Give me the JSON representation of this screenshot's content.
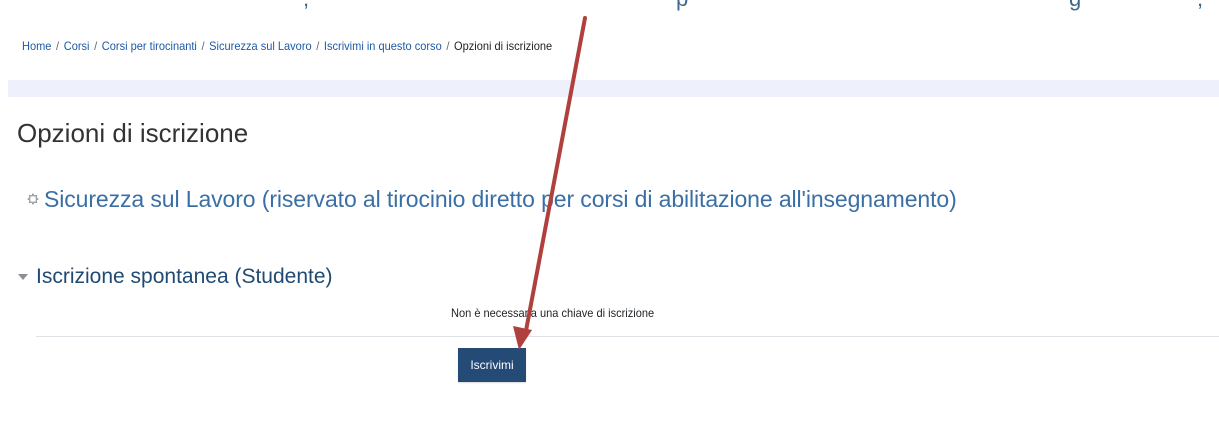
{
  "breadcrumb": [
    {
      "label": "Home",
      "link": true
    },
    {
      "label": "Corsi",
      "link": true
    },
    {
      "label": "Corsi per tirocinanti",
      "link": true
    },
    {
      "label": "Sicurezza sul Lavoro",
      "link": true
    },
    {
      "label": "Iscrivimi in questo corso",
      "link": true
    },
    {
      "label": "Opzioni di iscrizione",
      "link": false
    }
  ],
  "page": {
    "title": "Opzioni di iscrizione"
  },
  "course": {
    "name": "Sicurezza sul Lavoro (riservato al tirocinio diretto per corsi di abilitazione all'insegnamento)",
    "icon": "course-icon"
  },
  "enrolment": {
    "section_title": "Iscrizione spontanea (Studente)",
    "section_icon": "caret-down-icon",
    "info": "Non è necessaria una chiave di iscrizione",
    "button_label": "Iscrivimi"
  },
  "annotation": {
    "arrow_color": "#b0403d"
  },
  "colors": {
    "link": "#1c5aa6",
    "course_link": "#3a6fa5",
    "section_title": "#1f4a73",
    "button_bg": "#244a76",
    "band": "#eef0fb"
  }
}
